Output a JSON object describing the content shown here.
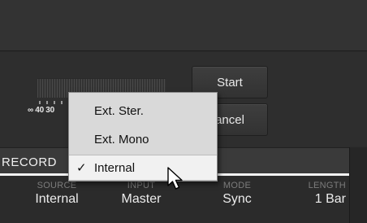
{
  "meter": {
    "scale_text": "∞ 40 30"
  },
  "buttons": {
    "start": "Start",
    "cancel": "ancel"
  },
  "record_section": {
    "title": "RECORD"
  },
  "params": {
    "source": {
      "label": "SOURCE",
      "value": "Internal"
    },
    "input": {
      "label": "INPUT",
      "value": "Master"
    },
    "mode": {
      "label": "MODE",
      "value": "Sync"
    },
    "length": {
      "label": "LENGTH",
      "value": "1 Bar"
    }
  },
  "dropdown": {
    "items": [
      {
        "label": "Ext. Ster.",
        "checked": false
      },
      {
        "label": "Ext. Mono",
        "checked": false
      },
      {
        "label": "Internal",
        "checked": true
      }
    ],
    "check_glyph": "✓"
  },
  "colors": {
    "background": "#2c2c2c",
    "dropdown_bg": "#d9d9d9",
    "highlight": "#f1f1f1"
  },
  "icons": {
    "cursor": "arrow-pointer-icon"
  }
}
